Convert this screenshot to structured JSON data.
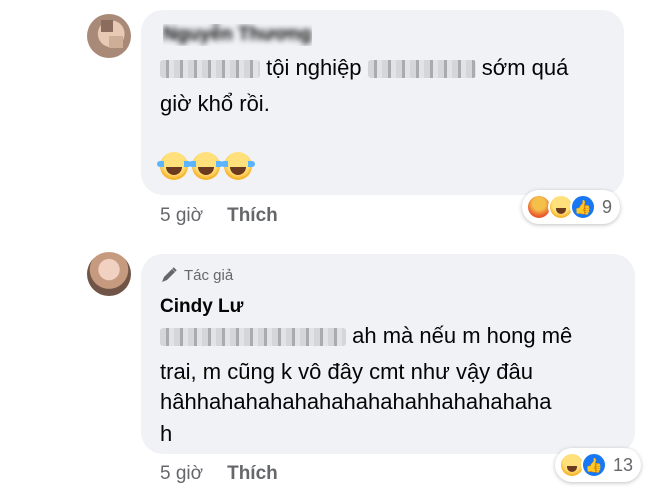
{
  "comments": [
    {
      "author_name": "Nguyễn Thương",
      "text_middle": "tội nghiệp",
      "text_end": "sớm quá",
      "text_line2": "giờ khổ rồi.",
      "time": "5 giờ",
      "like_label": "Thích",
      "reaction_count": "9",
      "reactions": [
        "angry-icon",
        "haha-icon",
        "like-icon"
      ]
    },
    {
      "badge": "Tác giả",
      "author_name": "Cindy Lư",
      "text_line1": "ah mà nếu m hong mê",
      "text_line2": "trai, m cũng k vô đây cmt như vậy đâu",
      "text_line3": "hâhhahahahahahahahahahhahahahaha",
      "text_line4": "h",
      "time": "5 giờ",
      "like_label": "Thích",
      "reaction_count": "13",
      "reactions": [
        "haha-icon",
        "like-icon"
      ]
    }
  ]
}
